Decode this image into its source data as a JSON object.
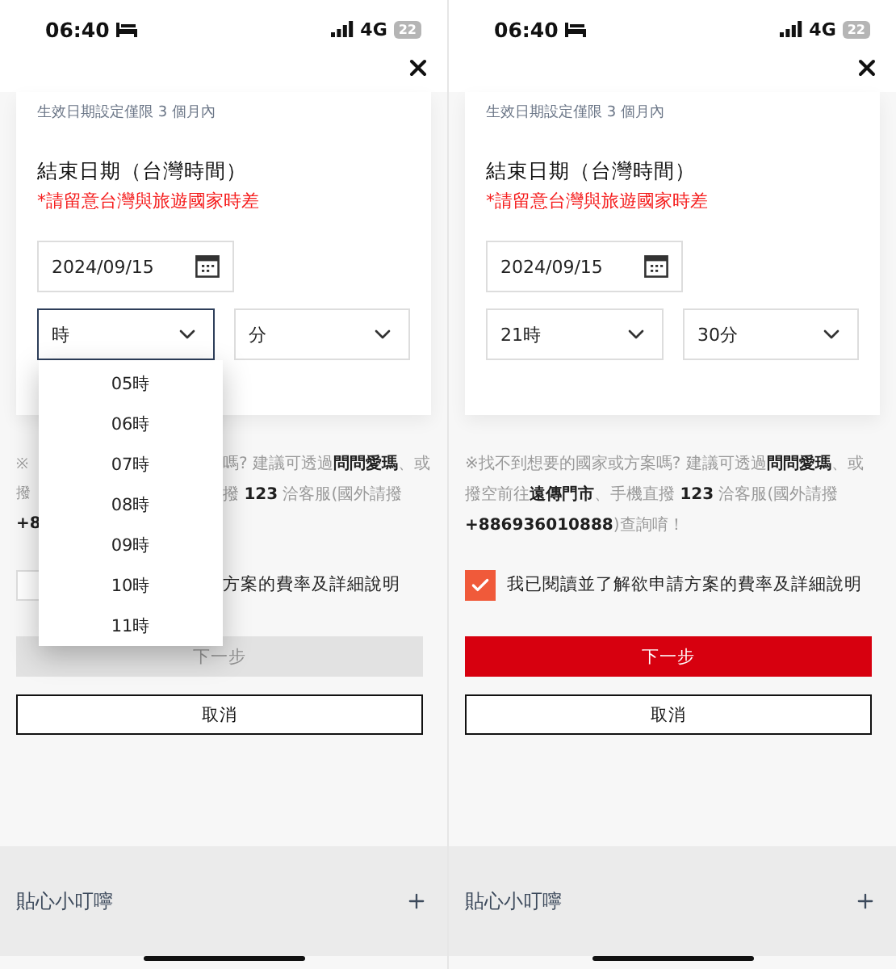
{
  "screens": [
    {
      "status_bar": {
        "time": "06:40",
        "network": "4G",
        "battery": "22"
      },
      "validity_note": "生效日期設定僅限 3 個月內",
      "end_date": {
        "title": "結束日期（台灣時間）",
        "warning": "*請留意台灣與旅遊國家時差",
        "date": "2024/09/15",
        "hour": {
          "value": "時",
          "focused": true
        },
        "minute": {
          "value": "分",
          "focused": false
        }
      },
      "hour_menu": [
        "05時",
        "06時",
        "07時",
        "08時",
        "09時",
        "10時",
        "11時"
      ],
      "notice_lines": [
        {
          "left": "※",
          "right": "嗎? 建議可透過**問問愛瑪**、或"
        },
        {
          "left": "撥",
          "right": "撥 **123** 洽客服(國外請撥"
        },
        {
          "left": "**+8**"
        }
      ],
      "agree": {
        "checked": false,
        "label": "方案的費率及詳細說明"
      },
      "next_button": {
        "label": "下一步",
        "disabled": true
      },
      "cancel_button": "取消",
      "tips": {
        "label": "貼心小叮嚀",
        "expanded": false
      }
    },
    {
      "status_bar": {
        "time": "06:40",
        "network": "4G",
        "battery": "22"
      },
      "validity_note": "生效日期設定僅限 3 個月內",
      "end_date": {
        "title": "結束日期（台灣時間）",
        "warning": "*請留意台灣與旅遊國家時差",
        "date": "2024/09/15",
        "hour": {
          "value": "21時",
          "focused": false
        },
        "minute": {
          "value": "30分",
          "focused": false
        }
      },
      "notice_lines": [
        {
          "left": "※找不到想要的國家或方案嗎? 建議可透過**問問愛瑪**、或"
        },
        {
          "left": "撥空前往**遠傳門市**、手機直撥 **123** 洽客服(國外請撥"
        },
        {
          "left": "**+886936010888**)查詢唷！"
        }
      ],
      "agree": {
        "checked": true,
        "label": "我已閱讀並了解欲申請方案的費率及詳細說明"
      },
      "next_button": {
        "label": "下一步",
        "disabled": false
      },
      "cancel_button": "取消",
      "tips": {
        "label": "貼心小叮嚀",
        "expanded": false
      }
    }
  ]
}
